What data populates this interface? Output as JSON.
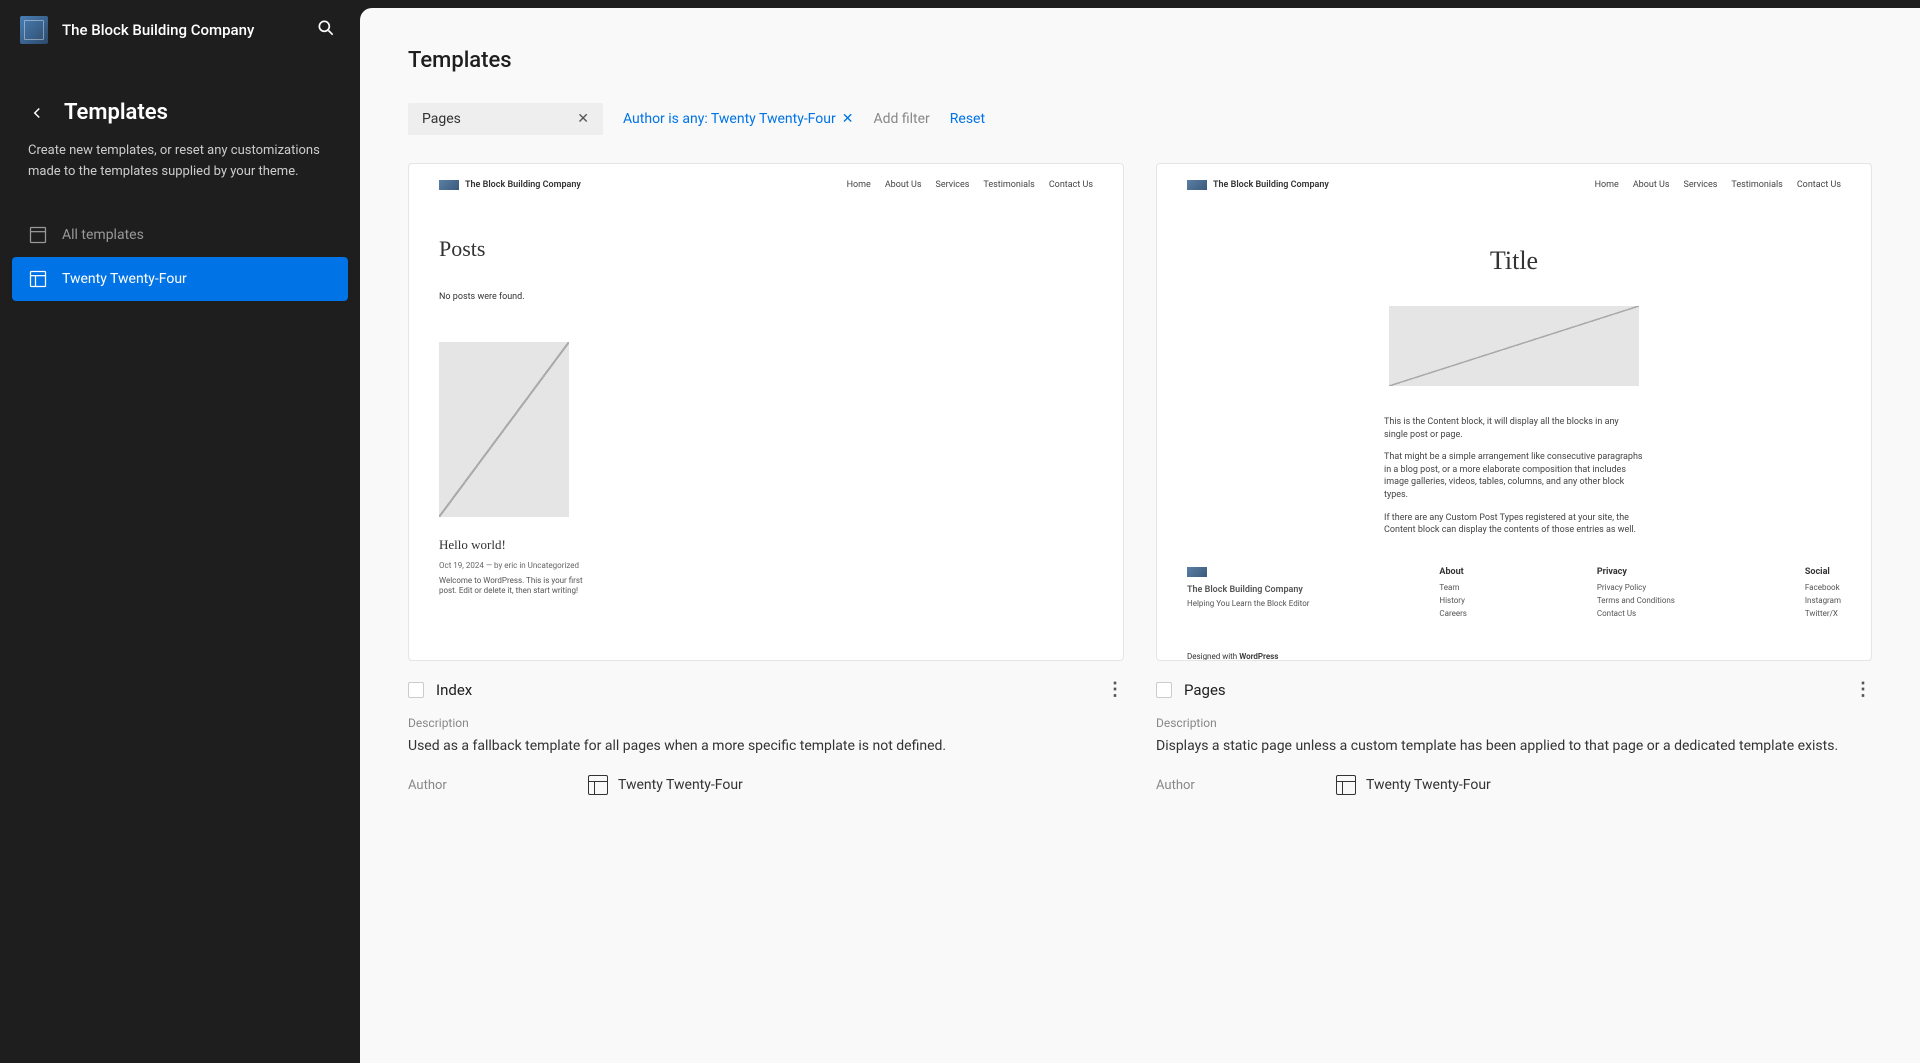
{
  "site": {
    "title": "The Block Building Company"
  },
  "sidebar": {
    "nav_title": "Templates",
    "description": "Create new templates, or reset any customizations made to the templates supplied by your theme.",
    "items": [
      {
        "label": "All templates"
      },
      {
        "label": "Twenty Twenty-Four"
      }
    ]
  },
  "main": {
    "title": "Templates",
    "filters": {
      "chip": "Pages",
      "author": "Author is any: Twenty Twenty-Four",
      "add": "Add filter",
      "reset": "Reset"
    },
    "cards": [
      {
        "title": "Index",
        "desc_label": "Description",
        "description": "Used as a fallback template for all pages when a more specific template is not defined.",
        "author_label": "Author",
        "author": "Twenty Twenty-Four",
        "preview": {
          "brand": "The Block Building Company",
          "menu": [
            "Home",
            "About Us",
            "Services",
            "Testimonials",
            "Contact Us"
          ],
          "posts_title": "Posts",
          "no_posts": "No posts were found.",
          "hello": "Hello world!",
          "meta": "Oct 19, 2024 — by eric in Uncategorized",
          "welcome": "Welcome to WordPress. This is your first post. Edit or delete it, then start writing!"
        }
      },
      {
        "title": "Pages",
        "desc_label": "Description",
        "description": "Displays a static page unless a custom template has been applied to that page or a dedicated template exists.",
        "author_label": "Author",
        "author": "Twenty Twenty-Four",
        "preview": {
          "brand": "The Block Building Company",
          "menu": [
            "Home",
            "About Us",
            "Services",
            "Testimonials",
            "Contact Us"
          ],
          "title": "Title",
          "p1": "This is the Content block, it will display all the blocks in any single post or page.",
          "p2": "That might be a simple arrangement like consecutive paragraphs in a blog post, or a more elaborate composition that includes image galleries, videos, tables, columns, and any other block types.",
          "p3": "If there are any Custom Post Types registered at your site, the Content block can display the contents of those entries as well.",
          "footer_brand": "The Block Building Company",
          "footer_tagline": "Helping You Learn the Block Editor",
          "cols": {
            "about": {
              "h": "About",
              "items": [
                "Team",
                "History",
                "Careers"
              ]
            },
            "privacy": {
              "h": "Privacy",
              "items": [
                "Privacy Policy",
                "Terms and Conditions",
                "Contact Us"
              ]
            },
            "social": {
              "h": "Social",
              "items": [
                "Facebook",
                "Instagram",
                "Twitter/X"
              ]
            }
          },
          "designed_pre": "Designed with ",
          "designed_strong": "WordPress"
        }
      }
    ]
  }
}
